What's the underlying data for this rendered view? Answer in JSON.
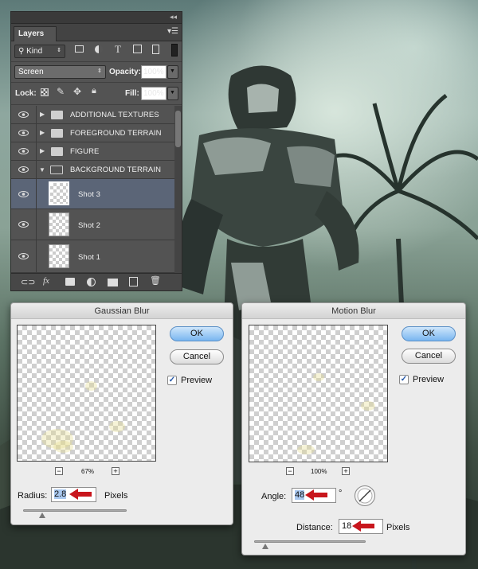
{
  "colors": {
    "panel": "#535353",
    "dialog": "#ececec",
    "arrow": "#c8161d",
    "ok": "#79b6f0"
  },
  "layers_panel": {
    "tab": "Layers",
    "filter_kind": "Kind",
    "blend_mode": "Screen",
    "opacity_label": "Opacity:",
    "opacity_value": "100%",
    "lock_label": "Lock:",
    "fill_label": "Fill:",
    "fill_value": "100%",
    "groups": [
      "ADDITIONAL TEXTURES",
      "FOREGROUND TERRAIN",
      "FIGURE",
      "BACKGROUND TERRAIN"
    ],
    "layers": [
      "Shot 3",
      "Shot 2",
      "Shot 1"
    ],
    "bottom_icons": [
      "link-icon",
      "fx-icon",
      "mask-icon",
      "adjustment-icon",
      "folder-icon",
      "new-layer-icon",
      "trash-icon"
    ]
  },
  "gaussian": {
    "title": "Gaussian Blur",
    "ok": "OK",
    "cancel": "Cancel",
    "preview": "Preview",
    "zoom": "67%",
    "radius_label": "Radius:",
    "radius_value": "2.8",
    "radius_unit": "Pixels"
  },
  "motion": {
    "title": "Motion Blur",
    "ok": "OK",
    "cancel": "Cancel",
    "preview": "Preview",
    "zoom": "100%",
    "angle_label": "Angle:",
    "angle_value": "48",
    "angle_unit": "°",
    "distance_label": "Distance:",
    "distance_value": "18",
    "distance_unit": "Pixels"
  }
}
